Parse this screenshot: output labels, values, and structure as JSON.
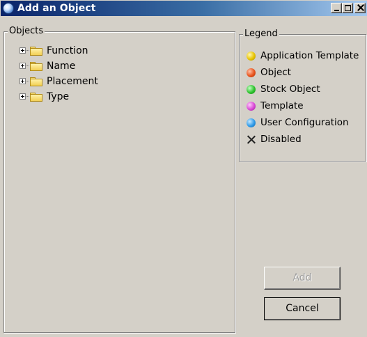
{
  "window": {
    "title": "Add an Object",
    "controls": {
      "minimize": "minimize",
      "maximize": "maximize",
      "close": "close"
    }
  },
  "objects_panel": {
    "legend": "Objects",
    "tree": [
      {
        "label": "Function",
        "icon": "folder-icon",
        "expander": "plus"
      },
      {
        "label": "Name",
        "icon": "folder-icon",
        "expander": "plus"
      },
      {
        "label": "Placement",
        "icon": "folder-icon",
        "expander": "plus"
      },
      {
        "label": "Type",
        "icon": "folder-icon",
        "expander": "plus"
      }
    ]
  },
  "legend_panel": {
    "legend": "Legend",
    "items": [
      {
        "label": "Application Template",
        "color": "#e8c400"
      },
      {
        "label": "Object",
        "color": "#e8531c"
      },
      {
        "label": "Stock Object",
        "color": "#2ec32e"
      },
      {
        "label": "Template",
        "color": "#d94bd6"
      },
      {
        "label": "User Configuration",
        "color": "#2f9ae8"
      },
      {
        "label": "Disabled",
        "icon": "x-icon"
      }
    ]
  },
  "buttons": {
    "add": "Add",
    "cancel": "Cancel"
  }
}
